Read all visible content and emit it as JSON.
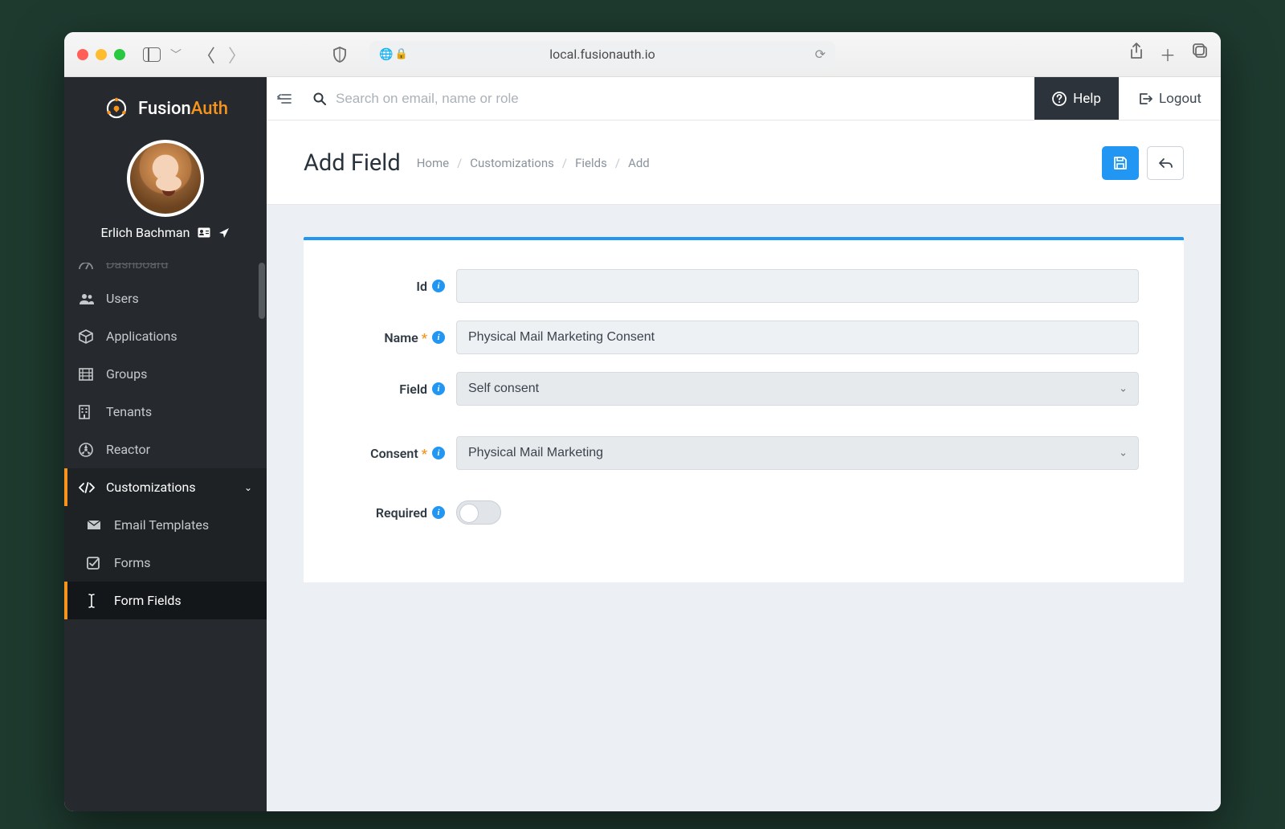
{
  "browser": {
    "url": "local.fusionauth.io"
  },
  "brand": {
    "name_pre": "Fusion",
    "name_post": "Auth"
  },
  "user": {
    "name": "Erlich Bachman"
  },
  "sidebar": {
    "items": [
      {
        "label": "Dashboard"
      },
      {
        "label": "Users"
      },
      {
        "label": "Applications"
      },
      {
        "label": "Groups"
      },
      {
        "label": "Tenants"
      },
      {
        "label": "Reactor"
      },
      {
        "label": "Customizations"
      }
    ],
    "subitems": [
      {
        "label": "Email Templates"
      },
      {
        "label": "Forms"
      },
      {
        "label": "Form Fields"
      }
    ]
  },
  "topbar": {
    "search_placeholder": "Search on email, name or role",
    "help": "Help",
    "logout": "Logout"
  },
  "page": {
    "title": "Add Field",
    "breadcrumb": [
      "Home",
      "Customizations",
      "Fields",
      "Add"
    ]
  },
  "form": {
    "labels": {
      "id": "Id",
      "name": "Name",
      "field": "Field",
      "consent": "Consent",
      "required": "Required"
    },
    "values": {
      "id": "",
      "name": "Physical Mail Marketing Consent",
      "field": "Self consent",
      "consent": "Physical Mail Marketing",
      "required": false
    }
  }
}
